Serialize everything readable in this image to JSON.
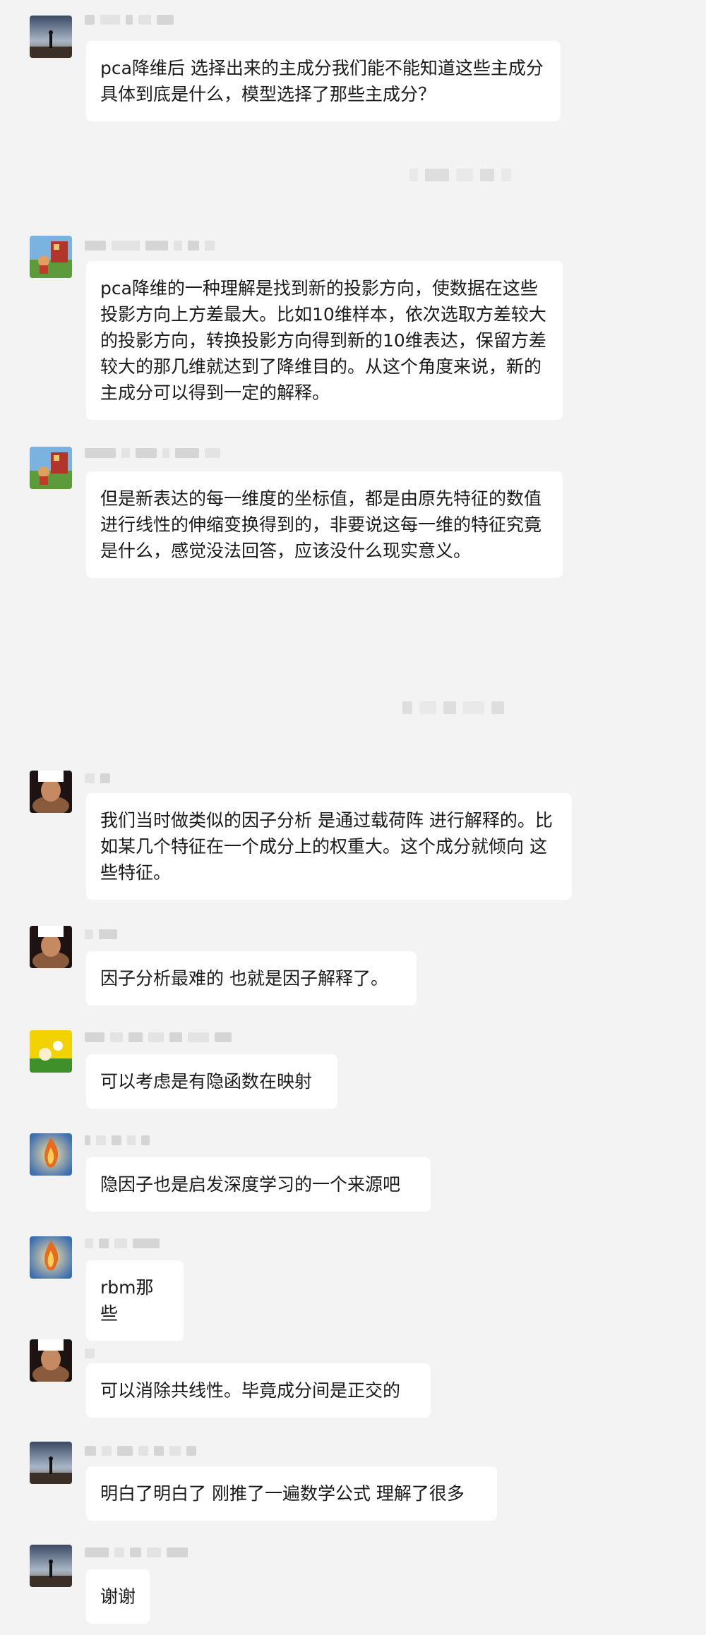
{
  "chat": {
    "messages": [
      {
        "avatar": "silhouette-avatar",
        "text": "pca降维后 选择出来的主成分我们能不能知道这些主成分具体到底是什么，模型选择了那些主成分？"
      },
      {
        "avatar": "game-character-avatar",
        "text": "pca降维的一种理解是找到新的投影方向，使数据在这些投影方向上方差最大。比如10维样本，依次选取方差较大的投影方向，转换投影方向得到新的10维表达，保留方差较大的那几维就达到了降维目的。从这个角度来说，新的主成分可以得到一定的解释。"
      },
      {
        "avatar": "game-character-avatar",
        "text": "但是新表达的每一维度的坐标值，都是由原先特征的数值进行线性的伸缩变换得到的，非要说这每一维的特征究竟是什么，感觉没法回答，应该没什么现实意义。"
      },
      {
        "avatar": "portrait-avatar",
        "text": "我们当时做类似的因子分析 是通过载荷阵 进行解释的。比如某几个特征在一个成分上的权重大。这个成分就倾向 这些特征。"
      },
      {
        "avatar": "portrait-avatar",
        "text": "因子分析最难的 也就是因子解释了。"
      },
      {
        "avatar": "yellow-cartoon-avatar",
        "text": "可以考虑是有隐函数在映射"
      },
      {
        "avatar": "flame-logo-avatar",
        "text": "隐因子也是启发深度学习的一个来源吧"
      },
      {
        "avatar": "flame-logo-avatar",
        "text": "rbm那些"
      },
      {
        "avatar": "portrait-avatar",
        "text": "可以消除共线性。毕竟成分间是正交的"
      },
      {
        "avatar": "silhouette-avatar",
        "text": "明白了明白了 刚推了一遍数学公式 理解了很多"
      },
      {
        "avatar": "silhouette-avatar",
        "text": "谢谢"
      }
    ]
  }
}
